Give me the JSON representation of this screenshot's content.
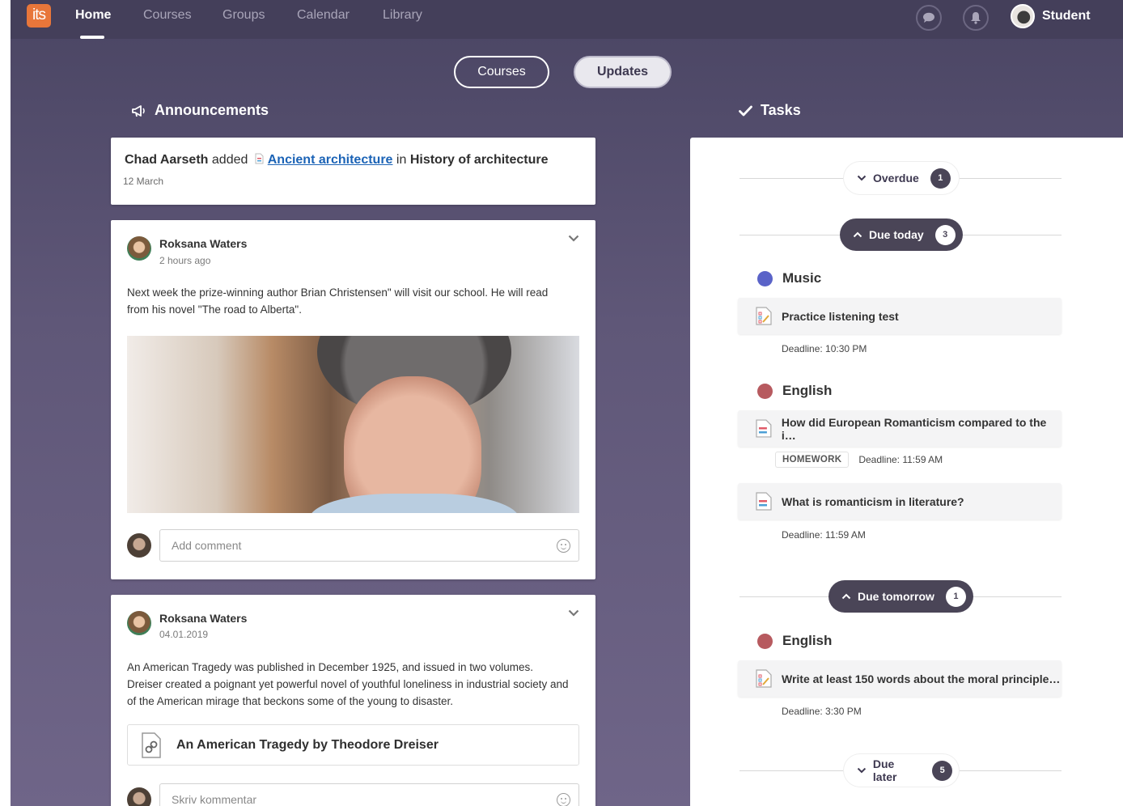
{
  "nav": {
    "logo": "its",
    "links": [
      "Home",
      "Courses",
      "Groups",
      "Calendar",
      "Library"
    ],
    "active": "Home",
    "user_name": "Student"
  },
  "toggle": {
    "courses": "Courses",
    "updates": "Updates",
    "selected": "Updates"
  },
  "announcements": {
    "title": "Announcements",
    "item": {
      "author": "Chad Aarseth",
      "verb": "added",
      "link": "Ancient architecture",
      "preposition": "in",
      "course": "History of architecture",
      "date": "12 March"
    }
  },
  "posts": [
    {
      "author": "Roksana Waters",
      "time": "2 hours ago",
      "text": "Next week the prize-winning author Brian Christensen\" will visit our school. He will read from his novel \"The road to Alberta\".",
      "comment_placeholder": "Add comment"
    },
    {
      "author": "Roksana Waters",
      "time": "04.01.2019",
      "text": "An American Tragedy was published in December 1925, and issued in two volumes. Dreiser created a poignant yet powerful novel of youthful loneliness in industrial society and of the American mirage that beckons some of the young to disaster.",
      "attachment": "An American Tragedy by Theodore Dreiser",
      "comment_placeholder": "Skriv kommentar"
    }
  ],
  "tasks": {
    "title": "Tasks",
    "groups": {
      "overdue": {
        "label": "Overdue",
        "count": "1"
      },
      "due_today": {
        "label": "Due today",
        "count": "3"
      },
      "due_tomorrow": {
        "label": "Due tomorrow",
        "count": "1"
      },
      "due_later": {
        "label": "Due later",
        "count": "5"
      }
    },
    "today": {
      "music": {
        "course": "Music",
        "color": "#5a63c8",
        "task": "Practice listening test",
        "deadline": "Deadline: 10:30 PM"
      },
      "english": {
        "course": "English",
        "color": "#b75a5f",
        "task1": "How did European Romanticism compared to the i…",
        "task1_badge": "HOMEWORK",
        "task1_deadline": "Deadline: 11:59 AM",
        "task2": "What is romanticism in literature?",
        "task2_deadline": "Deadline: 11:59 AM"
      }
    },
    "tomorrow": {
      "english": {
        "course": "English",
        "color": "#b75a5f",
        "task": "Write at least 150 words about the moral principle…",
        "deadline": "Deadline: 3:30 PM"
      }
    }
  }
}
